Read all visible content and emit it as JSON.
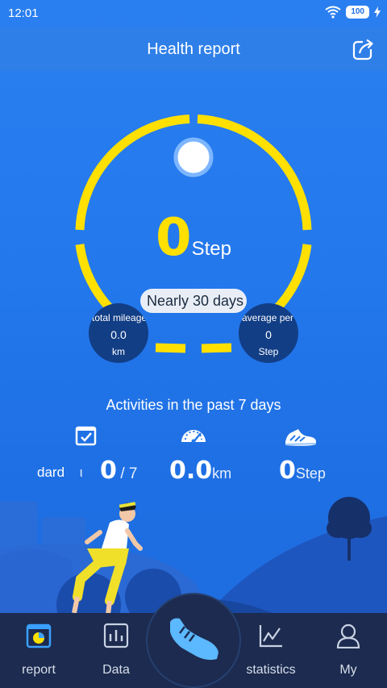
{
  "status_bar": {
    "time": "12:01",
    "battery": "100"
  },
  "header": {
    "title": "Health report"
  },
  "summary": {
    "step_value": "0",
    "step_unit": "Step",
    "period_label": "Nearly 30 days",
    "total_mile": {
      "label": "total mileage",
      "value": "0.0",
      "unit": "km"
    },
    "average": {
      "label": "average per day",
      "value": "0",
      "unit": "Step"
    }
  },
  "activities": {
    "title": "Activities in the past 7 days",
    "standard": {
      "label": "dard",
      "label_suffix": "ι",
      "value": "0",
      "total": "/ 7"
    },
    "distance": {
      "value": "0.0",
      "unit": "km"
    },
    "steps": {
      "value": "0",
      "unit": "Step"
    }
  },
  "nav": {
    "items": [
      {
        "label": "report",
        "icon": "report-icon"
      },
      {
        "label": "Data",
        "icon": "data-chart-icon"
      },
      {
        "label": "",
        "icon": "shoe-icon"
      },
      {
        "label": "statistics",
        "icon": "statistics-icon"
      },
      {
        "label": "My",
        "icon": "user-icon"
      }
    ]
  },
  "colors": {
    "accent": "#ffe000",
    "background": "#2378ec",
    "nav_bg": "#1c2b4f",
    "report_active": "#3aa0ff"
  }
}
